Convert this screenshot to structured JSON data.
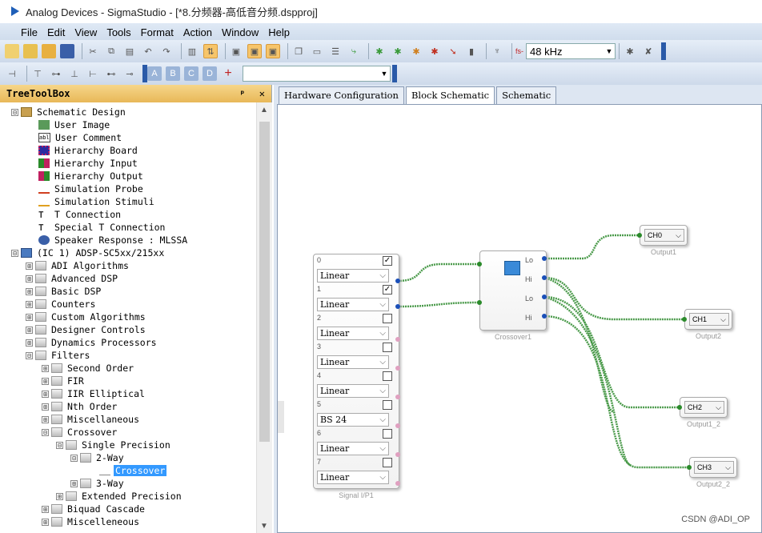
{
  "window": {
    "title": "Analog Devices - SigmaStudio - [*8.分频器-高低音分频.dspproj]"
  },
  "menu": [
    "File",
    "Edit",
    "View",
    "Tools",
    "Format",
    "Action",
    "Window",
    "Help"
  ],
  "toolbar": {
    "sample_rate": "48 kHz",
    "fs_label": "fs-"
  },
  "toolbox": {
    "title": "TreeToolBox",
    "pin": "ᵖ",
    "close": "✕",
    "items": [
      {
        "label": "Schematic Design",
        "pm": "⊟"
      },
      {
        "label": "User Image"
      },
      {
        "label": "User Comment"
      },
      {
        "label": "Hierarchy Board"
      },
      {
        "label": "Hierarchy Input"
      },
      {
        "label": "Hierarchy Output"
      },
      {
        "label": "Simulation Probe"
      },
      {
        "label": "Simulation Stimuli"
      },
      {
        "label": "T Connection"
      },
      {
        "label": "Special T Connection"
      },
      {
        "label": "Speaker Response : MLSSA"
      },
      {
        "label": "(IC 1) ADSP-SC5xx/215xx",
        "pm": "⊟"
      },
      {
        "label": "ADI Algorithms",
        "pm": "⊞"
      },
      {
        "label": "Advanced DSP",
        "pm": "⊞"
      },
      {
        "label": "Basic DSP",
        "pm": "⊞"
      },
      {
        "label": "Counters",
        "pm": "⊞"
      },
      {
        "label": "Custom Algorithms",
        "pm": "⊞"
      },
      {
        "label": "Designer Controls",
        "pm": "⊞"
      },
      {
        "label": "Dynamics Processors",
        "pm": "⊞"
      },
      {
        "label": "Filters",
        "pm": "⊟"
      },
      {
        "label": "Second Order",
        "pm": "⊞"
      },
      {
        "label": "FIR",
        "pm": "⊞"
      },
      {
        "label": "IIR Elliptical",
        "pm": "⊞"
      },
      {
        "label": "Nth Order",
        "pm": "⊞"
      },
      {
        "label": "Miscellaneous",
        "pm": "⊞"
      },
      {
        "label": "Crossover",
        "pm": "⊟"
      },
      {
        "label": "Single Precision",
        "pm": "⊟"
      },
      {
        "label": "2-Way",
        "pm": "⊟"
      },
      {
        "label": "Crossover"
      },
      {
        "label": "3-Way",
        "pm": "⊞"
      },
      {
        "label": "Extended Precision",
        "pm": "⊞"
      },
      {
        "label": "Biquad Cascade",
        "pm": "⊞"
      },
      {
        "label": "Miscelleneous",
        "pm": "⊞"
      }
    ]
  },
  "tabs": [
    "Hardware Configuration",
    "Block Schematic",
    "Schematic"
  ],
  "signal_input": {
    "label": "Signal I/P1",
    "channels": [
      {
        "num": "0",
        "mode": "Linear",
        "checked": "✓"
      },
      {
        "num": "1",
        "mode": "Linear",
        "checked": "✓"
      },
      {
        "num": "2",
        "mode": "Linear",
        "checked": ""
      },
      {
        "num": "3",
        "mode": "Linear",
        "checked": ""
      },
      {
        "num": "4",
        "mode": "Linear",
        "checked": ""
      },
      {
        "num": "5",
        "mode": "BS 24",
        "checked": ""
      },
      {
        "num": "6",
        "mode": "Linear",
        "checked": ""
      },
      {
        "num": "7",
        "mode": "Linear",
        "checked": ""
      }
    ]
  },
  "crossover": {
    "label": "Crossover1",
    "ports": [
      "Lo",
      "Hi",
      "Lo",
      "Hi"
    ]
  },
  "outputs": [
    {
      "ch": "CH0",
      "label": "Output1"
    },
    {
      "ch": "CH1",
      "label": "Output2"
    },
    {
      "ch": "CH2",
      "label": "Output1_2"
    },
    {
      "ch": "CH3",
      "label": "Output2_2"
    }
  ],
  "watermark": "CSDN @ADI_OP",
  "colors": {
    "accent": "#3399ff",
    "wire": "#4a9a4a",
    "pin": "#1a4fb8"
  }
}
